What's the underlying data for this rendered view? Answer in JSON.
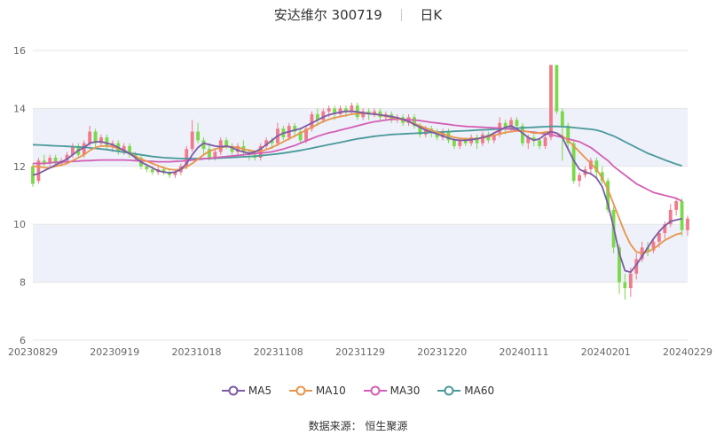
{
  "title": {
    "name": "安达维尔 300719",
    "period": "日K"
  },
  "source": "数据来源： 恒生聚源",
  "colors": {
    "up": "#f07a8a",
    "down": "#7ad94a",
    "ma5": "#7d5aa6",
    "ma10": "#e8954a",
    "ma30": "#d45fb4",
    "ma60": "#4a9a9a",
    "band": "#eef0fa"
  },
  "chart_data": {
    "type": "candlestick",
    "ylim": [
      6,
      16
    ],
    "yticks": [
      6,
      8,
      10,
      12,
      14,
      16
    ],
    "xticks": [
      "20230829",
      "20230919",
      "20231018",
      "20231108",
      "20231129",
      "20231220",
      "20240111",
      "20240201",
      "20240229"
    ],
    "legend": [
      "MA5",
      "MA10",
      "MA30",
      "MA60"
    ],
    "candles": [
      [
        12.0,
        11.4,
        12.1,
        11.3
      ],
      [
        11.5,
        12.2,
        12.3,
        11.4
      ],
      [
        12.2,
        12.1,
        12.4,
        12.0
      ],
      [
        12.1,
        12.3,
        12.4,
        12.0
      ],
      [
        12.3,
        12.1,
        12.4,
        12.0
      ],
      [
        12.1,
        12.2,
        12.3,
        12.0
      ],
      [
        12.2,
        12.4,
        12.5,
        12.1
      ],
      [
        12.4,
        12.7,
        12.8,
        12.3
      ],
      [
        12.7,
        12.4,
        12.8,
        12.3
      ],
      [
        12.4,
        12.8,
        12.9,
        12.3
      ],
      [
        12.8,
        13.2,
        13.4,
        12.7
      ],
      [
        13.2,
        12.8,
        13.3,
        12.6
      ],
      [
        12.8,
        13.0,
        13.1,
        12.7
      ],
      [
        13.0,
        12.7,
        13.1,
        12.6
      ],
      [
        12.7,
        12.8,
        12.9,
        12.5
      ],
      [
        12.8,
        12.5,
        12.9,
        12.4
      ],
      [
        12.5,
        12.7,
        12.8,
        12.4
      ],
      [
        12.7,
        12.4,
        12.8,
        12.3
      ],
      [
        12.4,
        12.3,
        12.5,
        12.2
      ],
      [
        12.3,
        12.0,
        12.4,
        11.9
      ],
      [
        12.0,
        11.9,
        12.1,
        11.8
      ],
      [
        11.9,
        11.8,
        12.0,
        11.7
      ],
      [
        11.8,
        11.9,
        12.0,
        11.7
      ],
      [
        11.9,
        11.8,
        12.0,
        11.7
      ],
      [
        11.8,
        11.7,
        11.9,
        11.6
      ],
      [
        11.7,
        11.8,
        11.9,
        11.6
      ],
      [
        11.8,
        12.0,
        12.1,
        11.7
      ],
      [
        12.0,
        12.6,
        12.7,
        11.9
      ],
      [
        12.6,
        13.2,
        13.6,
        12.5
      ],
      [
        13.2,
        12.9,
        13.5,
        12.8
      ],
      [
        12.9,
        12.6,
        13.0,
        12.4
      ],
      [
        12.6,
        12.3,
        12.8,
        12.2
      ],
      [
        12.3,
        12.5,
        12.6,
        12.2
      ],
      [
        12.5,
        12.9,
        13.0,
        12.4
      ],
      [
        12.9,
        12.7,
        13.0,
        12.6
      ],
      [
        12.7,
        12.5,
        12.8,
        12.4
      ],
      [
        12.5,
        12.7,
        12.8,
        12.4
      ],
      [
        12.7,
        12.5,
        12.9,
        12.3
      ],
      [
        12.5,
        12.4,
        12.6,
        12.2
      ],
      [
        12.4,
        12.3,
        12.5,
        12.2
      ],
      [
        12.3,
        12.7,
        12.8,
        12.2
      ],
      [
        12.7,
        12.9,
        13.0,
        12.6
      ],
      [
        12.9,
        12.8,
        13.0,
        12.6
      ],
      [
        12.8,
        13.3,
        13.5,
        12.7
      ],
      [
        13.3,
        13.0,
        13.4,
        12.9
      ],
      [
        13.0,
        13.4,
        13.5,
        12.9
      ],
      [
        13.4,
        13.2,
        13.5,
        13.0
      ],
      [
        13.2,
        12.9,
        13.3,
        12.8
      ],
      [
        12.9,
        13.3,
        13.4,
        12.8
      ],
      [
        13.3,
        13.8,
        13.9,
        13.2
      ],
      [
        13.8,
        13.6,
        14.0,
        13.4
      ],
      [
        13.6,
        13.9,
        14.0,
        13.5
      ],
      [
        13.9,
        14.0,
        14.1,
        13.7
      ],
      [
        14.0,
        13.8,
        14.1,
        13.6
      ],
      [
        13.8,
        14.0,
        14.1,
        13.7
      ],
      [
        14.0,
        13.9,
        14.1,
        13.7
      ],
      [
        13.9,
        14.1,
        14.2,
        13.8
      ],
      [
        14.1,
        13.7,
        14.2,
        13.6
      ],
      [
        13.7,
        13.9,
        14.0,
        13.6
      ],
      [
        13.9,
        13.8,
        14.0,
        13.6
      ],
      [
        13.8,
        13.9,
        14.0,
        13.7
      ],
      [
        13.9,
        13.7,
        14.0,
        13.6
      ],
      [
        13.7,
        13.8,
        13.9,
        13.6
      ],
      [
        13.8,
        13.6,
        13.9,
        13.5
      ],
      [
        13.6,
        13.7,
        13.8,
        13.5
      ],
      [
        13.7,
        13.5,
        13.8,
        13.4
      ],
      [
        13.5,
        13.7,
        13.8,
        13.4
      ],
      [
        13.7,
        13.4,
        13.8,
        13.3
      ],
      [
        13.4,
        13.1,
        13.5,
        13.0
      ],
      [
        13.1,
        13.3,
        13.4,
        13.0
      ],
      [
        13.3,
        13.2,
        13.4,
        13.0
      ],
      [
        13.2,
        13.0,
        13.3,
        12.9
      ],
      [
        13.0,
        13.2,
        13.3,
        12.9
      ],
      [
        13.2,
        12.9,
        13.3,
        12.8
      ],
      [
        12.9,
        12.7,
        13.0,
        12.6
      ],
      [
        12.7,
        12.9,
        13.0,
        12.6
      ],
      [
        12.9,
        12.8,
        13.0,
        12.7
      ],
      [
        12.8,
        13.0,
        13.1,
        12.7
      ],
      [
        13.0,
        12.8,
        13.1,
        12.6
      ],
      [
        12.8,
        13.1,
        13.2,
        12.7
      ],
      [
        13.1,
        12.9,
        13.2,
        12.8
      ],
      [
        12.9,
        13.1,
        13.2,
        12.8
      ],
      [
        13.1,
        13.5,
        13.7,
        13.0
      ],
      [
        13.5,
        13.3,
        13.6,
        13.1
      ],
      [
        13.3,
        13.6,
        13.7,
        13.2
      ],
      [
        13.6,
        13.4,
        13.7,
        13.2
      ],
      [
        13.4,
        12.8,
        13.5,
        12.7
      ],
      [
        12.8,
        13.0,
        13.1,
        12.6
      ],
      [
        13.0,
        12.9,
        13.1,
        12.7
      ],
      [
        12.9,
        12.7,
        13.0,
        12.6
      ],
      [
        12.7,
        13.0,
        13.2,
        12.6
      ],
      [
        13.0,
        15.5,
        15.5,
        12.9
      ],
      [
        15.5,
        13.9,
        15.5,
        13.8
      ],
      [
        13.9,
        13.4,
        14.0,
        12.2
      ],
      [
        13.4,
        12.8,
        13.5,
        12.6
      ],
      [
        12.8,
        11.5,
        12.9,
        11.4
      ],
      [
        11.5,
        11.7,
        11.8,
        11.3
      ],
      [
        11.7,
        11.9,
        12.0,
        11.6
      ],
      [
        11.9,
        12.2,
        12.3,
        11.7
      ],
      [
        12.2,
        11.8,
        12.3,
        11.6
      ],
      [
        11.8,
        11.5,
        12.0,
        11.4
      ],
      [
        11.5,
        10.5,
        11.6,
        10.4
      ],
      [
        10.5,
        9.2,
        10.6,
        9.0
      ],
      [
        9.2,
        8.0,
        9.3,
        7.6
      ],
      [
        8.0,
        7.8,
        8.3,
        7.4
      ],
      [
        7.8,
        8.3,
        8.5,
        7.5
      ],
      [
        8.3,
        8.8,
        9.0,
        8.1
      ],
      [
        8.8,
        9.2,
        9.4,
        8.7
      ],
      [
        9.2,
        9.1,
        9.4,
        8.9
      ],
      [
        9.1,
        9.4,
        9.5,
        9.0
      ],
      [
        9.4,
        9.7,
        9.8,
        9.2
      ],
      [
        9.7,
        10.0,
        10.1,
        9.5
      ],
      [
        10.0,
        10.5,
        10.7,
        9.9
      ],
      [
        10.5,
        10.8,
        10.9,
        10.3
      ],
      [
        10.8,
        9.8,
        10.9,
        9.6
      ],
      [
        9.8,
        10.2,
        10.3,
        9.6
      ]
    ],
    "ma5": [
      11.7,
      11.75,
      11.85,
      11.95,
      12.05,
      12.15,
      12.25,
      12.4,
      12.55,
      12.65,
      12.8,
      12.85,
      12.85,
      12.8,
      12.75,
      12.65,
      12.55,
      12.45,
      12.3,
      12.15,
      12.05,
      11.95,
      11.85,
      11.8,
      11.78,
      11.8,
      11.9,
      12.1,
      12.4,
      12.65,
      12.8,
      12.75,
      12.7,
      12.68,
      12.7,
      12.65,
      12.55,
      12.5,
      12.45,
      12.5,
      12.6,
      12.75,
      12.9,
      13.05,
      13.15,
      13.2,
      13.25,
      13.3,
      13.4,
      13.5,
      13.6,
      13.7,
      13.78,
      13.83,
      13.87,
      13.9,
      13.9,
      13.88,
      13.85,
      13.82,
      13.8,
      13.78,
      13.75,
      13.72,
      13.68,
      13.62,
      13.55,
      13.45,
      13.35,
      13.25,
      13.18,
      13.12,
      13.05,
      12.98,
      12.92,
      12.9,
      12.9,
      12.92,
      12.95,
      13.0,
      13.05,
      13.15,
      13.25,
      13.35,
      13.4,
      13.3,
      13.15,
      13.0,
      12.9,
      12.95,
      13.1,
      13.2,
      13.15,
      13.0,
      12.6,
      12.2,
      11.9,
      11.8,
      11.75,
      11.6,
      11.3,
      10.7,
      9.9,
      9.0,
      8.4,
      8.35,
      8.6,
      8.9,
      9.2,
      9.5,
      9.75,
      9.95,
      10.1,
      10.15,
      10.2
    ],
    "ma10": [
      12.0,
      12.0,
      11.95,
      11.95,
      12.0,
      12.05,
      12.1,
      12.2,
      12.3,
      12.4,
      12.55,
      12.65,
      12.7,
      12.7,
      12.68,
      12.62,
      12.55,
      12.45,
      12.35,
      12.25,
      12.18,
      12.1,
      12.02,
      11.95,
      11.9,
      11.88,
      11.9,
      11.98,
      12.1,
      12.25,
      12.4,
      12.52,
      12.6,
      12.65,
      12.68,
      12.68,
      12.65,
      12.6,
      12.55,
      12.52,
      12.52,
      12.58,
      12.65,
      12.75,
      12.85,
      12.95,
      13.05,
      13.15,
      13.25,
      13.35,
      13.45,
      13.55,
      13.62,
      13.68,
      13.72,
      13.76,
      13.8,
      13.82,
      13.83,
      13.82,
      13.8,
      13.77,
      13.73,
      13.7,
      13.65,
      13.6,
      13.55,
      13.48,
      13.4,
      13.32,
      13.25,
      13.18,
      13.12,
      13.06,
      13.0,
      12.97,
      12.95,
      12.95,
      12.95,
      12.98,
      13.02,
      13.07,
      13.12,
      13.17,
      13.2,
      13.22,
      13.22,
      13.2,
      13.15,
      13.15,
      13.18,
      13.2,
      13.15,
      13.05,
      12.9,
      12.7,
      12.5,
      12.3,
      12.1,
      11.9,
      11.6,
      11.2,
      10.7,
      10.2,
      9.7,
      9.3,
      9.05,
      9.0,
      9.05,
      9.15,
      9.3,
      9.45,
      9.55,
      9.65,
      9.7
    ],
    "ma30": [
      12.1,
      12.1,
      12.1,
      12.12,
      12.14,
      12.15,
      12.16,
      12.17,
      12.18,
      12.2,
      12.2,
      12.21,
      12.22,
      12.22,
      12.22,
      12.22,
      12.22,
      12.21,
      12.2,
      12.19,
      12.18,
      12.17,
      12.16,
      12.16,
      12.16,
      12.17,
      12.18,
      12.2,
      12.22,
      12.24,
      12.26,
      12.28,
      12.3,
      12.32,
      12.34,
      12.36,
      12.38,
      12.4,
      12.42,
      12.44,
      12.46,
      12.48,
      12.5,
      12.55,
      12.6,
      12.66,
      12.72,
      12.8,
      12.88,
      12.96,
      13.04,
      13.1,
      13.16,
      13.2,
      13.25,
      13.3,
      13.35,
      13.4,
      13.45,
      13.5,
      13.54,
      13.57,
      13.6,
      13.62,
      13.63,
      13.62,
      13.61,
      13.6,
      13.58,
      13.55,
      13.52,
      13.5,
      13.47,
      13.45,
      13.42,
      13.4,
      13.38,
      13.37,
      13.36,
      13.35,
      13.34,
      13.33,
      13.32,
      13.3,
      13.28,
      13.25,
      13.22,
      13.2,
      13.18,
      13.15,
      13.12,
      13.1,
      13.05,
      13.0,
      12.95,
      12.9,
      12.85,
      12.75,
      12.65,
      12.5,
      12.35,
      12.2,
      12.0,
      11.85,
      11.7,
      11.55,
      11.4,
      11.3,
      11.2,
      11.1,
      11.05,
      11.0,
      10.95,
      10.9,
      10.8
    ],
    "ma60": [
      12.75,
      12.74,
      12.73,
      12.72,
      12.71,
      12.7,
      12.69,
      12.68,
      12.67,
      12.66,
      12.64,
      12.62,
      12.6,
      12.58,
      12.55,
      12.52,
      12.49,
      12.46,
      12.43,
      12.4,
      12.37,
      12.34,
      12.32,
      12.3,
      12.29,
      12.28,
      12.27,
      12.27,
      12.27,
      12.27,
      12.27,
      12.27,
      12.28,
      12.29,
      12.3,
      12.31,
      12.32,
      12.33,
      12.34,
      12.35,
      12.37,
      12.39,
      12.41,
      12.43,
      12.46,
      12.49,
      12.52,
      12.55,
      12.59,
      12.63,
      12.67,
      12.71,
      12.75,
      12.79,
      12.83,
      12.87,
      12.91,
      12.95,
      12.98,
      13.01,
      13.04,
      13.06,
      13.08,
      13.1,
      13.11,
      13.12,
      13.13,
      13.14,
      13.15,
      13.16,
      13.17,
      13.18,
      13.19,
      13.2,
      13.21,
      13.22,
      13.23,
      13.24,
      13.25,
      13.26,
      13.27,
      13.28,
      13.29,
      13.3,
      13.31,
      13.32,
      13.33,
      13.34,
      13.35,
      13.36,
      13.37,
      13.38,
      13.38,
      13.37,
      13.36,
      13.34,
      13.32,
      13.3,
      13.28,
      13.25,
      13.2,
      13.12,
      13.05,
      12.95,
      12.85,
      12.75,
      12.65,
      12.55,
      12.45,
      12.38,
      12.3,
      12.22,
      12.15,
      12.08,
      12.02
    ]
  }
}
